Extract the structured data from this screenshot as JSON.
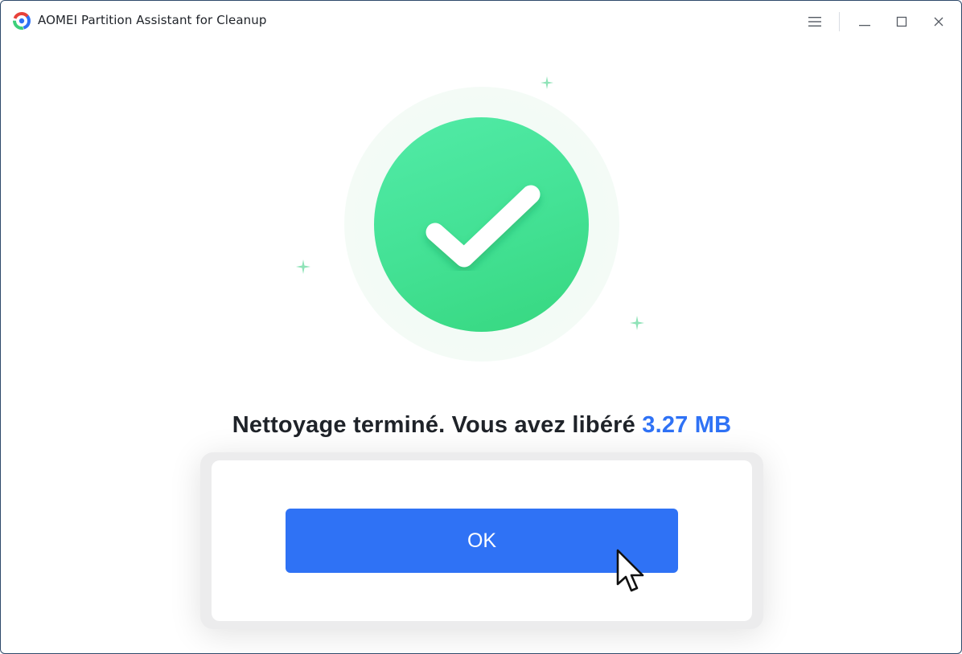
{
  "window": {
    "title": "AOMEI Partition Assistant for Cleanup",
    "controls": [
      "menu-icon",
      "minimize-icon",
      "maximize-icon",
      "close-icon"
    ]
  },
  "result": {
    "message_prefix": "Nettoyage terminé. Vous avez libéré ",
    "freed_amount": "3.27 MB",
    "icon": "check-circle-icon"
  },
  "actions": {
    "ok_label": "OK"
  },
  "colors": {
    "accent_blue": "#2f72f5",
    "success_green": "#44e296",
    "text_dark": "#1f2329"
  }
}
